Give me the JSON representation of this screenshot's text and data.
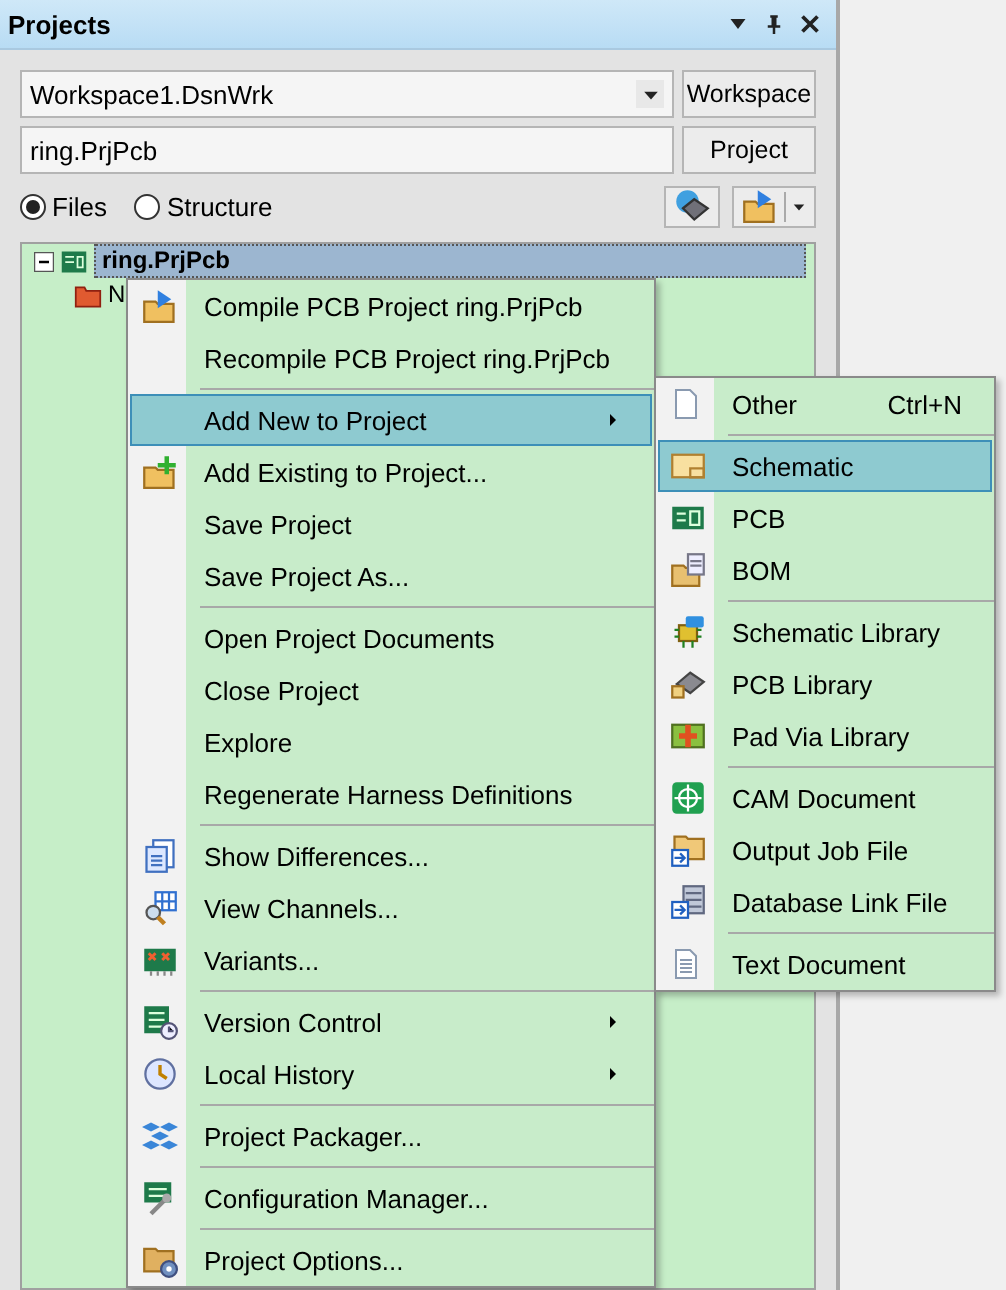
{
  "panel": {
    "title": "Projects"
  },
  "workspace_combo": {
    "value": "Workspace1.DsnWrk"
  },
  "workspace_button": {
    "label": "Workspace"
  },
  "project_field": {
    "value": "ring.PrjPcb"
  },
  "project_button": {
    "label": "Project"
  },
  "view_options": [
    {
      "label": "Files",
      "selected": true
    },
    {
      "label": "Structure",
      "selected": false
    }
  ],
  "tree": [
    {
      "label": "ring.PrjPcb",
      "expanded": true,
      "selected": true,
      "children": [
        {
          "label": "N",
          "selected": false
        }
      ]
    }
  ],
  "context_menu": {
    "items": [
      {
        "kind": "item",
        "label": "Compile PCB Project ring.PrjPcb",
        "submenu": false,
        "selected": false
      },
      {
        "kind": "item",
        "label": "Recompile PCB Project ring.PrjPcb",
        "submenu": false,
        "selected": false
      },
      {
        "kind": "separator"
      },
      {
        "kind": "item",
        "label": "Add New to Project",
        "submenu": true,
        "selected": true
      },
      {
        "kind": "item",
        "label": "Add Existing to Project...",
        "submenu": false,
        "selected": false
      },
      {
        "kind": "item",
        "label": "Save Project",
        "submenu": false,
        "selected": false
      },
      {
        "kind": "item",
        "label": "Save Project As...",
        "submenu": false,
        "selected": false
      },
      {
        "kind": "separator"
      },
      {
        "kind": "item",
        "label": "Open Project Documents",
        "submenu": false,
        "selected": false
      },
      {
        "kind": "item",
        "label": "Close Project",
        "submenu": false,
        "selected": false
      },
      {
        "kind": "item",
        "label": "Explore",
        "submenu": false,
        "selected": false
      },
      {
        "kind": "item",
        "label": "Regenerate Harness Definitions",
        "submenu": false,
        "selected": false
      },
      {
        "kind": "separator"
      },
      {
        "kind": "item",
        "label": "Show Differences...",
        "submenu": false,
        "selected": false
      },
      {
        "kind": "item",
        "label": "View Channels...",
        "submenu": false,
        "selected": false
      },
      {
        "kind": "item",
        "label": "Variants...",
        "submenu": false,
        "selected": false
      },
      {
        "kind": "separator"
      },
      {
        "kind": "item",
        "label": "Version Control",
        "submenu": true,
        "selected": false
      },
      {
        "kind": "item",
        "label": "Local History",
        "submenu": true,
        "selected": false
      },
      {
        "kind": "separator"
      },
      {
        "kind": "item",
        "label": "Project Packager...",
        "submenu": false,
        "selected": false
      },
      {
        "kind": "separator"
      },
      {
        "kind": "item",
        "label": "Configuration Manager...",
        "submenu": false,
        "selected": false
      },
      {
        "kind": "separator"
      },
      {
        "kind": "item",
        "label": "Project Options...",
        "submenu": false,
        "selected": false
      }
    ]
  },
  "submenu": {
    "items": [
      {
        "kind": "item",
        "label": "Other",
        "shortcut": "Ctrl+N",
        "selected": false
      },
      {
        "kind": "separator"
      },
      {
        "kind": "item",
        "label": "Schematic",
        "selected": true
      },
      {
        "kind": "item",
        "label": "PCB",
        "selected": false
      },
      {
        "kind": "item",
        "label": "BOM",
        "selected": false
      },
      {
        "kind": "separator"
      },
      {
        "kind": "item",
        "label": "Schematic Library",
        "selected": false
      },
      {
        "kind": "item",
        "label": "PCB Library",
        "selected": false
      },
      {
        "kind": "item",
        "label": "Pad Via Library",
        "selected": false
      },
      {
        "kind": "separator"
      },
      {
        "kind": "item",
        "label": "CAM Document",
        "selected": false
      },
      {
        "kind": "item",
        "label": "Output Job File",
        "selected": false
      },
      {
        "kind": "item",
        "label": "Database Link File",
        "selected": false
      },
      {
        "kind": "separator"
      },
      {
        "kind": "item",
        "label": "Text Document",
        "selected": false
      }
    ]
  }
}
